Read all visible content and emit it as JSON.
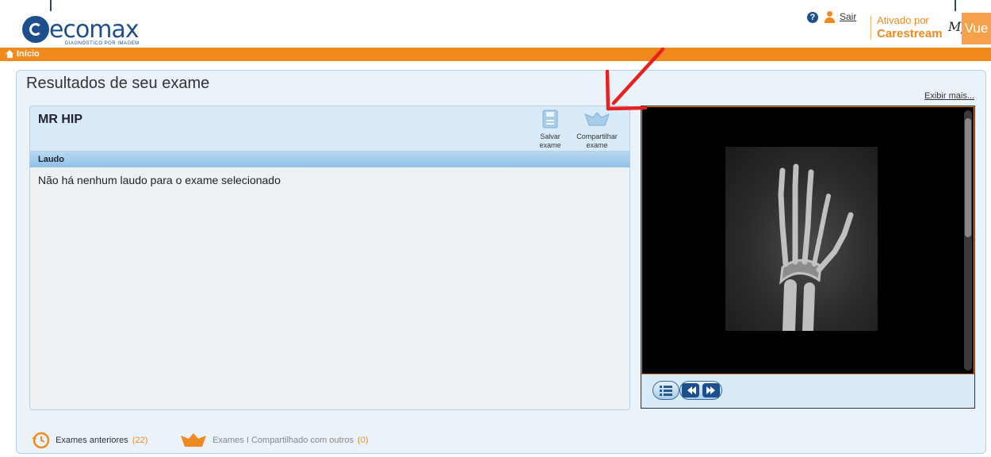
{
  "header": {
    "logo_text": "ecomax",
    "logo_sub": "DIAGNÓSTICO POR IMAGEM",
    "logout_label": "Sair",
    "powered_label": "Ativado por",
    "powered_brand": "Carestream",
    "product_prefix": "My",
    "product_name": "Vue"
  },
  "nav": {
    "home_label": "Início"
  },
  "main": {
    "title": "Resultados de seu exame",
    "show_more_label": "Exibir mais...",
    "exam": {
      "name": "MR HIP",
      "save_label_1": "Salvar",
      "save_label_2": "exame",
      "share_label_1": "Compartilhar",
      "share_label_2": "exame",
      "section_label": "Laudo",
      "empty_message": "Não há nenhum laudo para o exame selecionado"
    },
    "footer": {
      "previous_label": "Exames anteriores",
      "previous_count": "(22)",
      "shared_label": "Exames I Compartilhado com outros",
      "shared_count": "(0)"
    }
  },
  "colors": {
    "accent": "#f08a1e",
    "brand": "#1d4f8c",
    "panel": "#eaf3fa"
  }
}
